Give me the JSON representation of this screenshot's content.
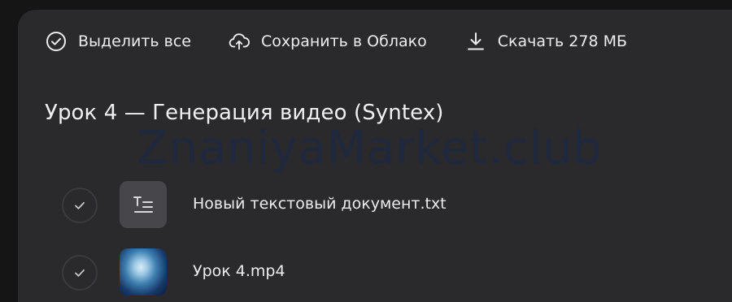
{
  "toolbar": {
    "select_all_label": "Выделить все",
    "save_cloud_label": "Сохранить в Облако",
    "download_label": "Скачать 278 МБ"
  },
  "folder_title": "Урок 4 — Генерация видео (Syntex)",
  "watermark": "ZnaniyaMarket.club",
  "files": [
    {
      "name": "Новый текстовый документ.txt",
      "icon": "text-document-icon"
    },
    {
      "name": "Урок 4.mp4",
      "icon": "video-thumbnail"
    }
  ],
  "colors": {
    "background": "#151515",
    "panel": "#2a292c",
    "text": "#ececee",
    "checkbox_border": "#3b3a3e",
    "txt_thumb": "#47464a"
  }
}
